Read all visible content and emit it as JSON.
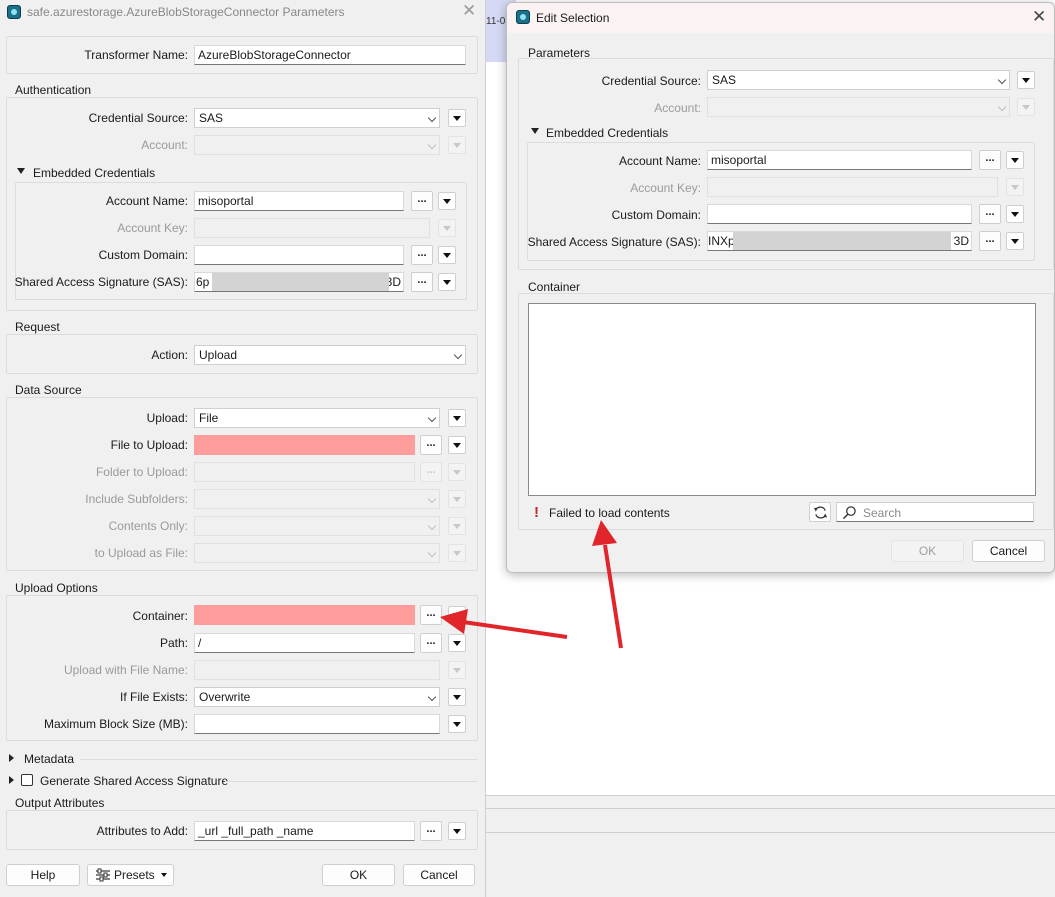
{
  "background": {
    "timeline_fragment": "11-0"
  },
  "params_dialog": {
    "title": "safe.azurestorage.AzureBlobStorageConnector Parameters",
    "transformer_name": {
      "label": "Transformer Name:",
      "value": "AzureBlobStorageConnector"
    },
    "authentication": {
      "title": "Authentication",
      "credential_source": {
        "label": "Credential Source:",
        "value": "SAS"
      },
      "account": {
        "label": "Account:",
        "value": ""
      },
      "embedded": {
        "title": "Embedded Credentials",
        "account_name": {
          "label": "Account Name:",
          "value": "misoportal"
        },
        "account_key": {
          "label": "Account Key:",
          "value": ""
        },
        "custom_domain": {
          "label": "Custom Domain:",
          "value": ""
        },
        "sas": {
          "label": "Shared Access Signature (SAS):",
          "value_start": "6p",
          "value_end": "3D"
        }
      }
    },
    "request": {
      "title": "Request",
      "action": {
        "label": "Action:",
        "value": "Upload"
      }
    },
    "data_source": {
      "title": "Data Source",
      "upload": {
        "label": "Upload:",
        "value": "File"
      },
      "file_to_upload": {
        "label": "File to Upload:",
        "value": ""
      },
      "folder_to_upload": {
        "label": "Folder to Upload:",
        "value": ""
      },
      "include_subfolders": {
        "label": "Include Subfolders:",
        "value": ""
      },
      "contents_only": {
        "label": "Contents Only:",
        "value": ""
      },
      "upload_as_file": {
        "label": "to Upload as File:",
        "value": ""
      }
    },
    "upload_options": {
      "title": "Upload Options",
      "container": {
        "label": "Container:",
        "value": ""
      },
      "path": {
        "label": "Path:",
        "value": "/"
      },
      "upload_with_file_name": {
        "label": "Upload with File Name:",
        "value": ""
      },
      "if_file_exists": {
        "label": "If File Exists:",
        "value": "Overwrite"
      },
      "max_block_size": {
        "label": "Maximum Block Size (MB):",
        "value": ""
      }
    },
    "metadata": {
      "title": "Metadata"
    },
    "generate_sas": {
      "title": "Generate Shared Access Signature"
    },
    "output_attributes": {
      "title": "Output Attributes",
      "attributes_to_add": {
        "label": "Attributes to Add:",
        "value": "_url _full_path _name"
      }
    },
    "buttons": {
      "help": "Help",
      "presets": "Presets",
      "ok": "OK",
      "cancel": "Cancel"
    },
    "browse_label": "..."
  },
  "edit_dialog": {
    "title": "Edit Selection",
    "parameters": {
      "title": "Parameters",
      "credential_source": {
        "label": "Credential Source:",
        "value": "SAS"
      },
      "account": {
        "label": "Account:",
        "value": ""
      },
      "embedded": {
        "title": "Embedded Credentials",
        "account_name": {
          "label": "Account Name:",
          "value": "misoportal"
        },
        "account_key": {
          "label": "Account Key:",
          "value": ""
        },
        "custom_domain": {
          "label": "Custom Domain:",
          "value": ""
        },
        "sas": {
          "label": "Shared Access Signature (SAS):",
          "value_start": "INXp",
          "value_end": "3D"
        }
      }
    },
    "container": {
      "title": "Container",
      "error_text": "Failed to load contents",
      "search_placeholder": "Search"
    },
    "buttons": {
      "ok": "OK",
      "cancel": "Cancel"
    }
  },
  "colors": {
    "error_field": "#ff9c9c",
    "annotation_arrow": "#e0262a",
    "background_canvas": "#ffffff",
    "timeline_strip": "#d5d9f5"
  }
}
